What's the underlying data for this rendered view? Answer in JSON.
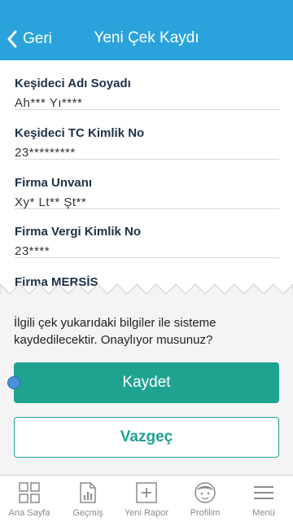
{
  "header": {
    "back_label": "Geri",
    "title": "Yeni Çek Kaydı"
  },
  "fields": [
    {
      "label": "Keşideci Adı Soyadı",
      "value": "Ah*** Yı****"
    },
    {
      "label": "Keşideci TC Kimlik No",
      "value": "23*********"
    },
    {
      "label": "Firma Unvanı",
      "value": "Xy* Lt** Şt**"
    },
    {
      "label": "Firma Vergi Kimlik No",
      "value": "23****"
    },
    {
      "label": "Firma MERSİS",
      "value": ""
    }
  ],
  "confirm": {
    "message": "İlgili çek yukarıdaki bilgiler ile sisteme kaydedilecektir. Onaylıyor musunuz?",
    "save_label": "Kaydet",
    "cancel_label": "Vazgeç"
  },
  "tabbar": {
    "items": [
      {
        "label": "Ana Sayfa",
        "icon": "home-grid-icon"
      },
      {
        "label": "Geçmiş",
        "icon": "history-report-icon"
      },
      {
        "label": "Yeni Rapor",
        "icon": "plus-box-icon"
      },
      {
        "label": "Profilim",
        "icon": "profile-face-icon"
      },
      {
        "label": "Menü",
        "icon": "hamburger-menu-icon"
      }
    ]
  },
  "colors": {
    "header": "#2aa3dc",
    "primary": "#1fa391",
    "sheet": "#f4f4f4"
  }
}
